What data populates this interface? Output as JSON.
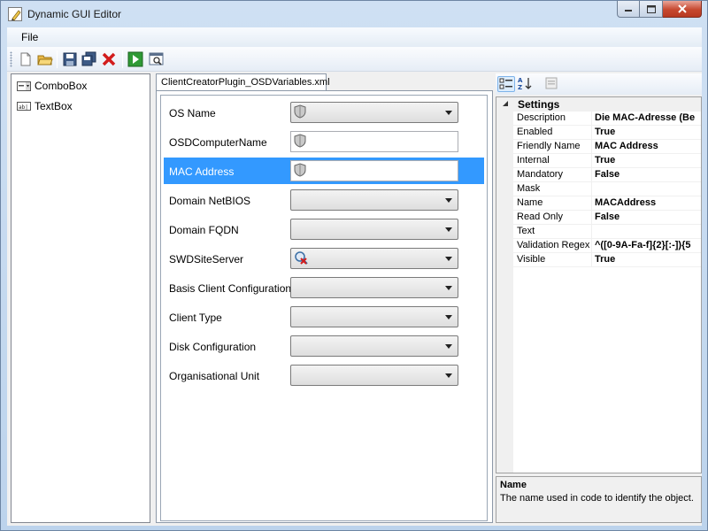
{
  "window": {
    "title": "Dynamic GUI Editor"
  },
  "menu": {
    "file": "File"
  },
  "toolbox": {
    "items": [
      {
        "label": "ComboBox",
        "icon": "combobox-icon"
      },
      {
        "label": "TextBox",
        "icon": "textbox-icon"
      }
    ]
  },
  "editor": {
    "tab": "ClientCreatorPlugin_OSDVariables.xml",
    "fields": [
      {
        "label": "OS Name",
        "control": "combobox",
        "icon": "shield-icon",
        "value": ""
      },
      {
        "label": "OSDComputerName",
        "control": "textbox",
        "icon": "shield-icon",
        "value": ""
      },
      {
        "label": "MAC Address",
        "control": "textbox",
        "icon": "shield-icon",
        "value": "",
        "selected": true
      },
      {
        "label": "Domain NetBIOS",
        "control": "combobox",
        "value": ""
      },
      {
        "label": "Domain FQDN",
        "control": "combobox",
        "value": ""
      },
      {
        "label": "SWDSiteServer",
        "control": "combobox",
        "icon": "error-icon",
        "value": ""
      },
      {
        "label": "Basis Client Configuration",
        "control": "combobox",
        "value": ""
      },
      {
        "label": "Client Type",
        "control": "combobox",
        "value": ""
      },
      {
        "label": "Disk Configuration",
        "control": "combobox",
        "value": ""
      },
      {
        "label": "Organisational Unit",
        "control": "combobox",
        "value": ""
      }
    ]
  },
  "properties": {
    "category": "Settings",
    "rows": [
      {
        "name": "Description",
        "value": "Die MAC-Adresse (Be"
      },
      {
        "name": "Enabled",
        "value": "True"
      },
      {
        "name": "Friendly Name",
        "value": "MAC Address"
      },
      {
        "name": "Internal",
        "value": "True"
      },
      {
        "name": "Mandatory",
        "value": "False"
      },
      {
        "name": "Mask",
        "value": ""
      },
      {
        "name": "Name",
        "value": "MACAddress"
      },
      {
        "name": "Read Only",
        "value": "False"
      },
      {
        "name": "Text",
        "value": ""
      },
      {
        "name": "Validation Regex",
        "value": "^([0-9A-Fa-f]{2}[:-]){5"
      },
      {
        "name": "Visible",
        "value": "True"
      }
    ],
    "description": {
      "title": "Name",
      "text": "The name used in code to identify the object."
    }
  },
  "colors": {
    "selection": "#3399ff",
    "close_button": "#c6482f"
  }
}
